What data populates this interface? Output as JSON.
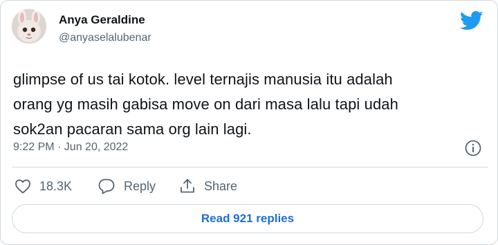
{
  "author": {
    "name": "Anya Geraldine",
    "handle": "@anyaselalubenar"
  },
  "tweet": {
    "lines": [
      "glimpse of us tai kotok. level ternajis manusia itu adalah",
      "orang yg masih gabisa move on dari masa lalu tapi udah",
      "sok2an pacaran sama org lain lagi."
    ],
    "timestamp": "9:22 PM · Jun 20, 2022"
  },
  "actions": {
    "like_count": "18.3K",
    "reply_label": "Reply",
    "share_label": "Share"
  },
  "read_replies_label": "Read 921 replies",
  "colors": {
    "twitter_blue": "#1d9bf0",
    "link_blue": "#1d6fd8",
    "secondary_text": "#536471",
    "border": "#cfd9de"
  },
  "icons": {
    "brand": "twitter-bird-icon",
    "info": "info-icon",
    "like": "heart-icon",
    "reply": "speech-bubble-icon",
    "share": "share-upload-icon"
  }
}
